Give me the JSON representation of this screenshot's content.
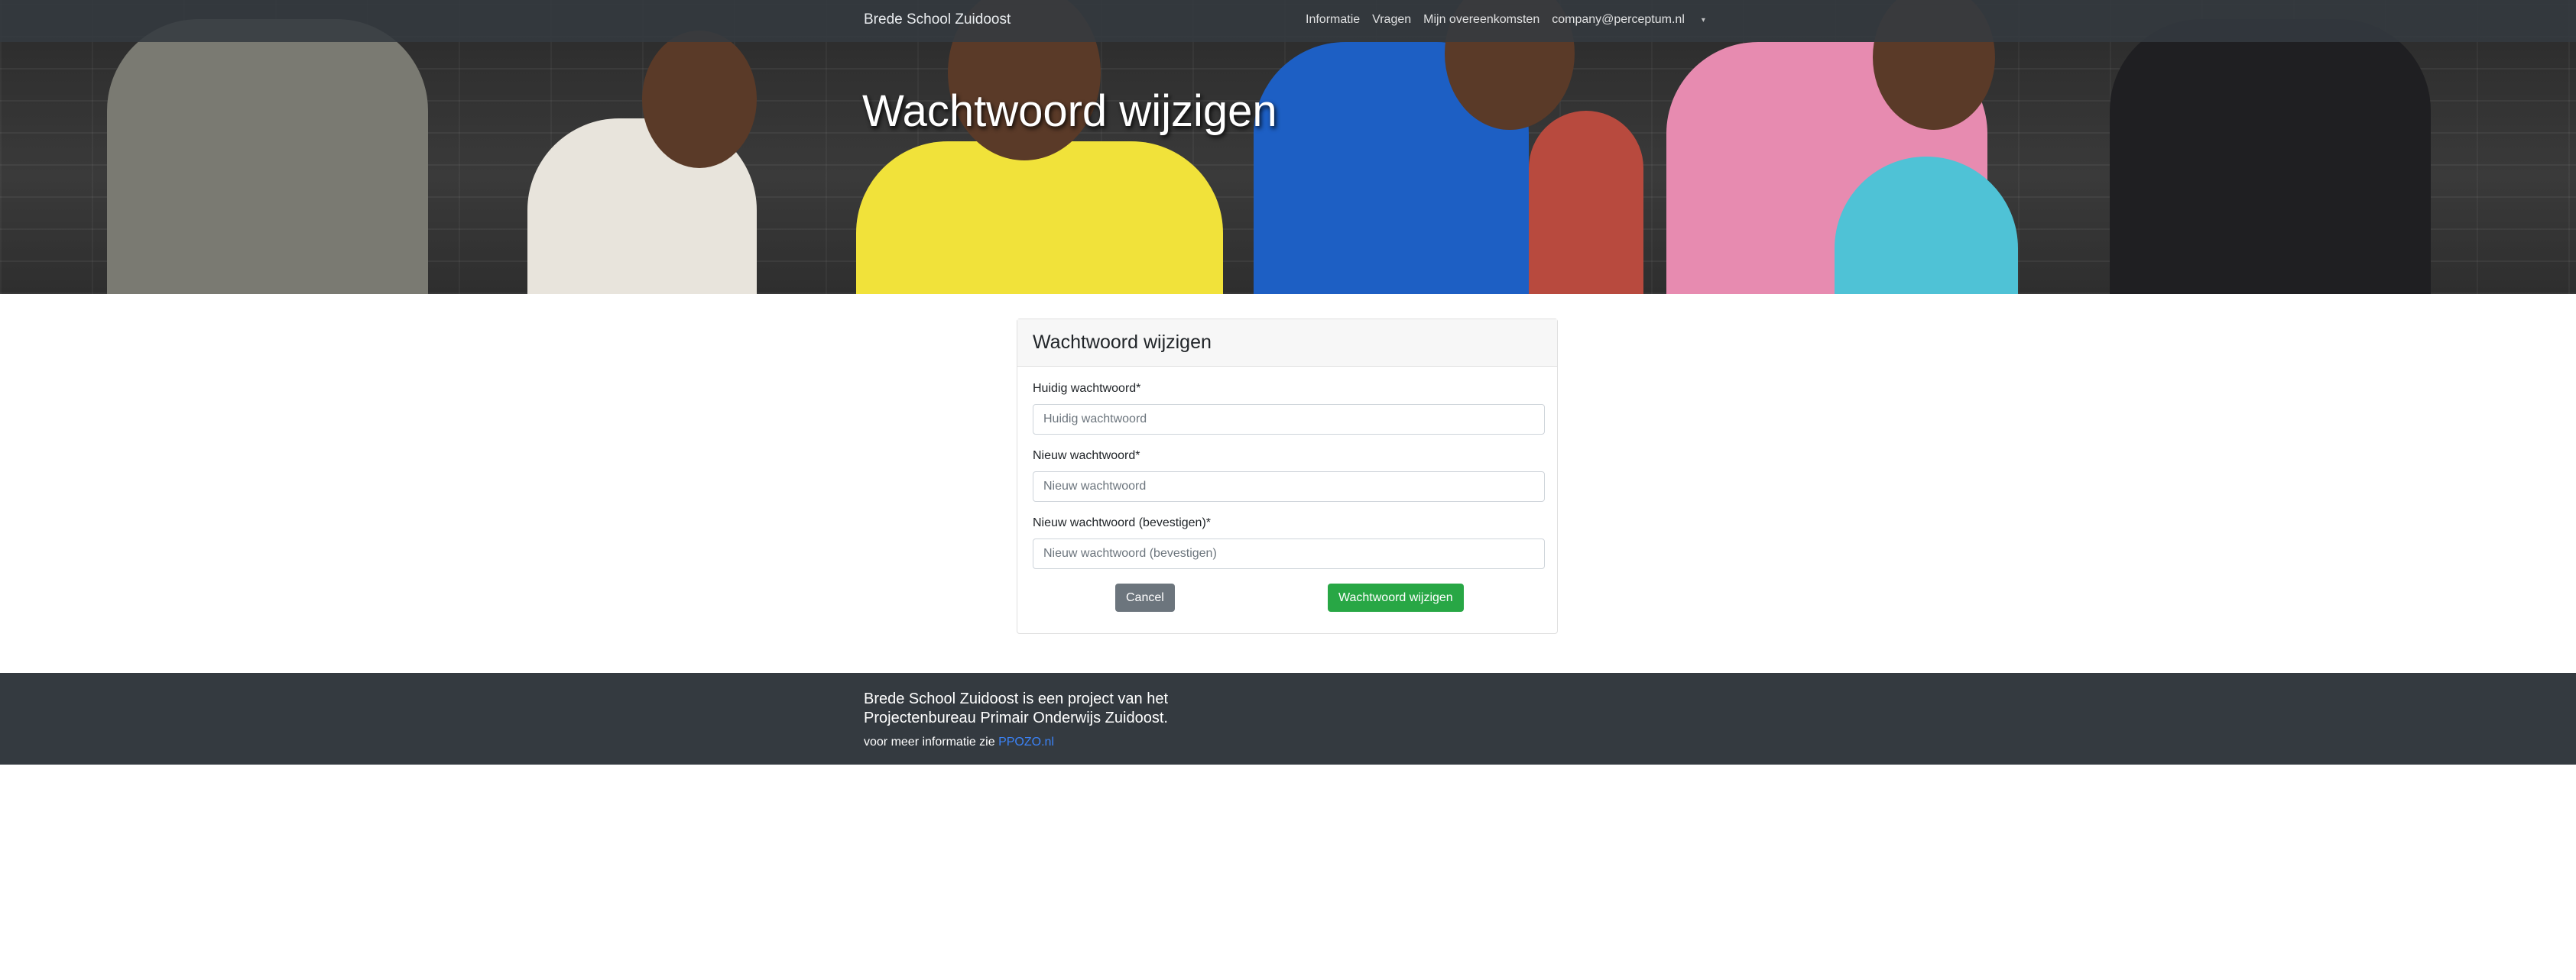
{
  "navbar": {
    "brand": "Brede School Zuidoost",
    "links": [
      "Informatie",
      "Vragen",
      "Mijn overeenkomsten",
      "company@perceptum.nl"
    ],
    "dropdown_caret": "▾"
  },
  "hero": {
    "title": "Wachtwoord wijzigen"
  },
  "form": {
    "title": "Wachtwoord wijzigen",
    "fields": [
      {
        "label": "Huidig wachtwoord*",
        "placeholder": "Huidig wachtwoord",
        "value": ""
      },
      {
        "label": "Nieuw wachtwoord*",
        "placeholder": "Nieuw wachtwoord",
        "value": ""
      },
      {
        "label": "Nieuw wachtwoord (bevestigen)*",
        "placeholder": "Nieuw wachtwoord (bevestigen)",
        "value": ""
      }
    ],
    "cancel_label": "Cancel",
    "submit_label": "Wachtwoord wijzigen"
  },
  "footer": {
    "text": "Brede School Zuidoost is een project van het Projectenbureau Primair Onderwijs Zuidoost.",
    "more_prefix": "voor meer informatie zie",
    "link_text": "PPOZO.nl"
  },
  "colors": {
    "navbar": "#343a40",
    "footer": "#343a40",
    "success": "#28a745",
    "secondary": "#6c757d",
    "link": "#3b82f6"
  }
}
